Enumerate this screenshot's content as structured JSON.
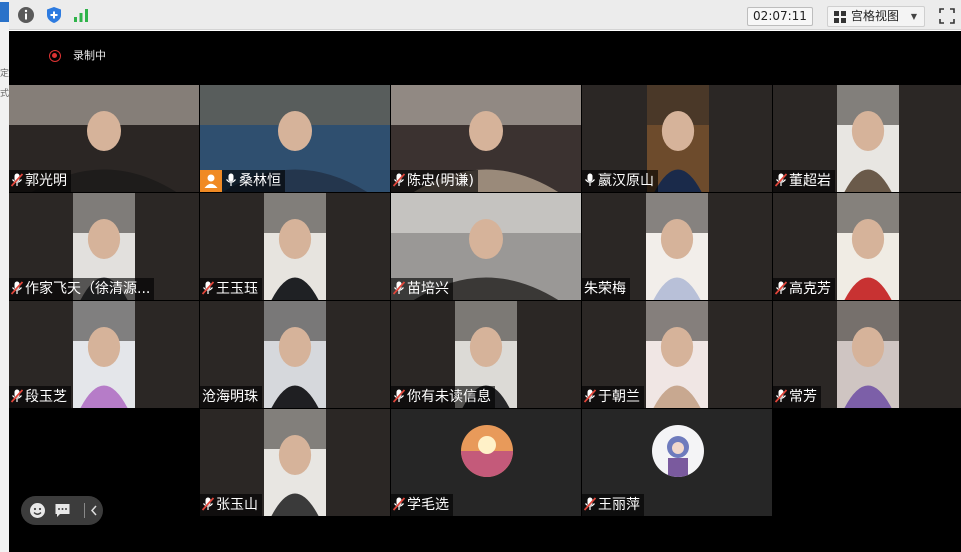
{
  "toolbar": {
    "info_icon": "info-icon",
    "shield_icon": "shield-icon",
    "signal_icon": "signal-bars-icon",
    "timer": "02:07:11",
    "view_label": "宫格视图",
    "fullscreen_icon": "fullscreen-icon"
  },
  "left_strip": {
    "chars": [
      "定",
      "式"
    ]
  },
  "recording": {
    "label": "录制中",
    "color": "#d33333"
  },
  "participants": [
    {
      "name": "郭光明",
      "mic": "muted"
    },
    {
      "name": "桑林恒",
      "mic": "on",
      "host": true,
      "highlighted": true
    },
    {
      "name": "陈忠(明谦)",
      "mic": "muted"
    },
    {
      "name": "嬴汉原山",
      "mic": "on"
    },
    {
      "name": "董超岩",
      "mic": "muted"
    },
    {
      "name": "作家飞天（徐清源...",
      "mic": "muted"
    },
    {
      "name": "王玉珏",
      "mic": "muted"
    },
    {
      "name": "苗培兴",
      "mic": "muted"
    },
    {
      "name": "朱荣梅",
      "mic": "none"
    },
    {
      "name": "高克芳",
      "mic": "muted"
    },
    {
      "name": "段玉芝",
      "mic": "muted"
    },
    {
      "name": "沧海明珠",
      "mic": "none"
    },
    {
      "name": "你有未读信息",
      "mic": "muted"
    },
    {
      "name": "于朝兰",
      "mic": "muted"
    },
    {
      "name": "常芳",
      "mic": "muted"
    },
    {
      "name": "",
      "mic": "none"
    },
    {
      "name": "张玉山",
      "mic": "muted"
    },
    {
      "name": "学毛选",
      "mic": "muted",
      "avatar": true
    },
    {
      "name": "王丽萍",
      "mic": "muted",
      "avatar": true
    }
  ],
  "controls": [
    "emoji-icon",
    "chat-icon",
    "collapse-chevron-icon"
  ],
  "colors": {
    "highlight": "#2ee07d",
    "host_badge": "#f08a24",
    "muted_mic": "#e0453a",
    "stage_bg": "#000000"
  }
}
